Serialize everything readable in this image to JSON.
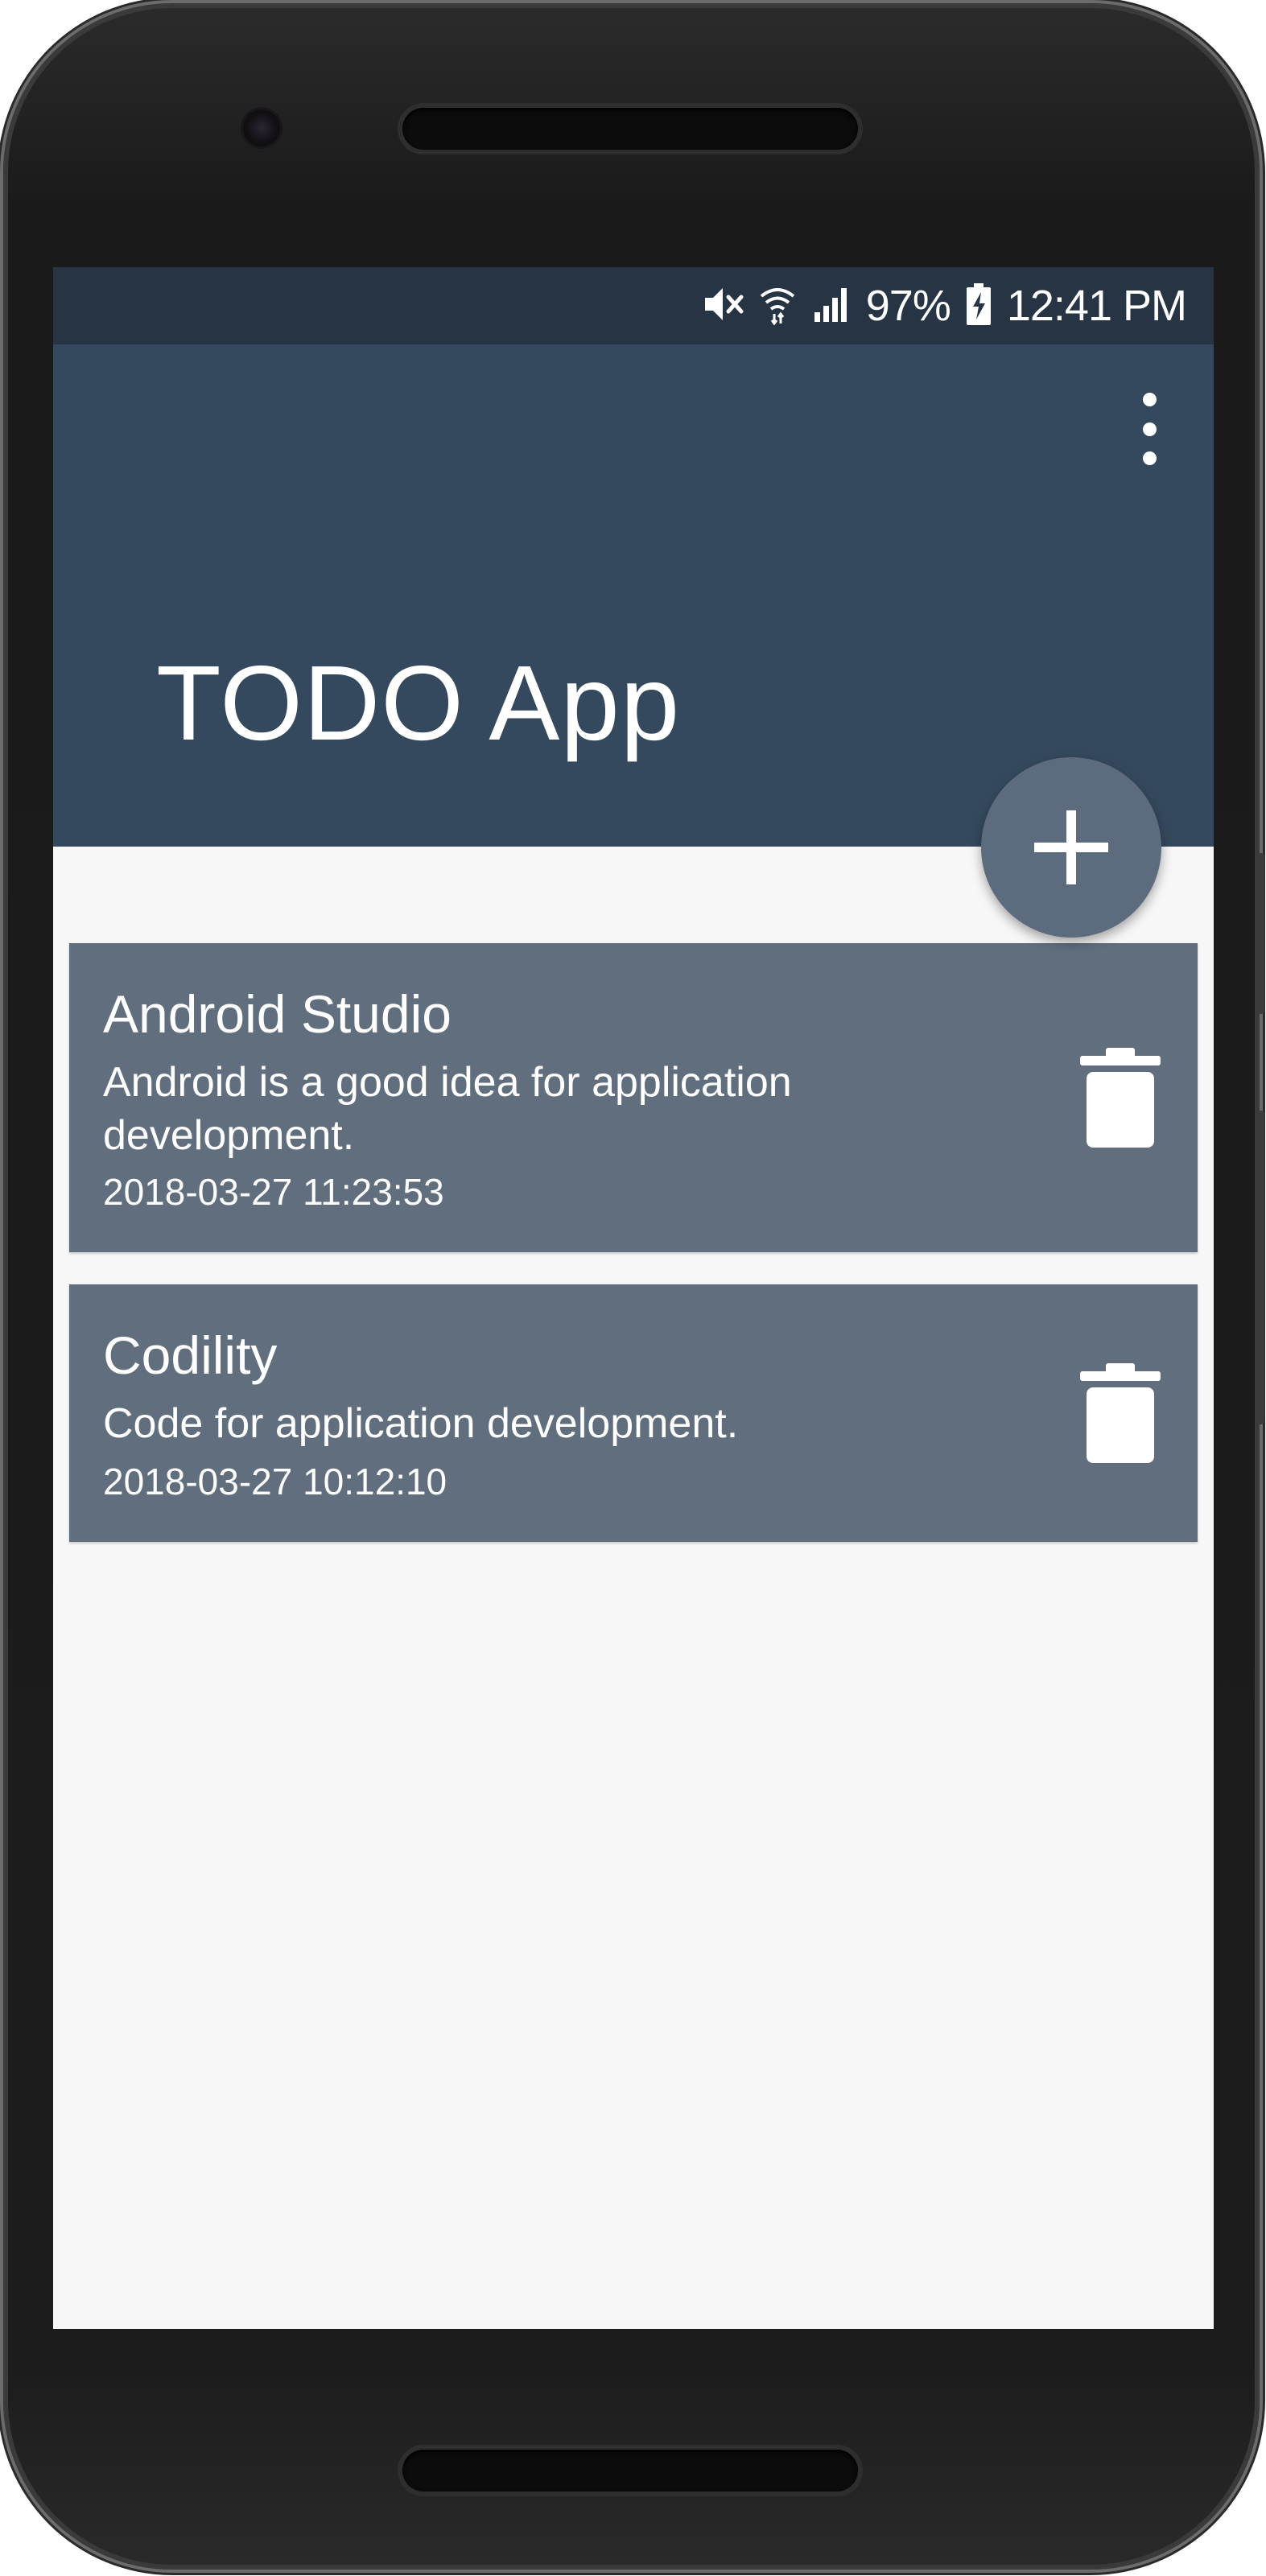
{
  "status_bar": {
    "battery_percent": "97%",
    "time": "12:41 PM",
    "icons": [
      "mute-icon",
      "wifi-icon",
      "signal-icon",
      "battery-charging-icon"
    ]
  },
  "app_bar": {
    "title": "TODO App",
    "menu_icon": "overflow-menu-icon",
    "color": "#35495e"
  },
  "fab": {
    "icon": "plus-icon",
    "color": "#5c6b7d"
  },
  "todos": [
    {
      "title": "Android Studio",
      "description": "Android is a good idea for application development.",
      "date": "2018-03-27 11:23:53",
      "delete_icon": "trash-icon"
    },
    {
      "title": "Codility",
      "description": "Code for application development.",
      "date": "2018-03-27 10:12:10",
      "delete_icon": "trash-icon"
    }
  ],
  "colors": {
    "status_bar": "#263444",
    "card": "#606e7e",
    "background": "#f7f7f7"
  }
}
